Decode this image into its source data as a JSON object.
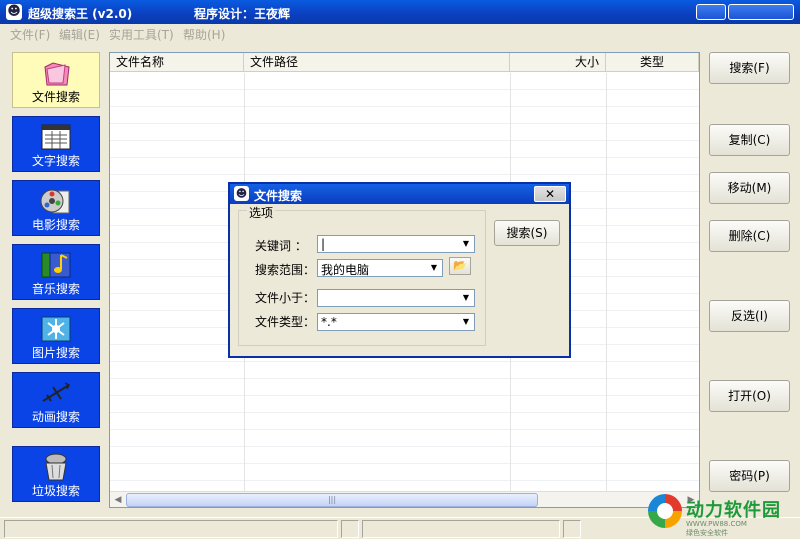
{
  "window": {
    "title": "超级搜索王 (v2.0)",
    "designer": "程序设计：王夜辉"
  },
  "menu": [
    "文件(F)",
    "编辑(E)",
    "实用工具(T)",
    "帮助(H)"
  ],
  "sidebar": {
    "items": [
      {
        "label": "文件搜索",
        "icon": "folder-icon",
        "active": true
      },
      {
        "label": "文字搜索",
        "icon": "text-document-icon"
      },
      {
        "label": "电影搜索",
        "icon": "film-reel-icon"
      },
      {
        "label": "音乐搜索",
        "icon": "music-note-icon"
      },
      {
        "label": "图片搜索",
        "icon": "picture-icon"
      },
      {
        "label": "动画搜索",
        "icon": "airplane-animation-icon"
      },
      {
        "label": "垃圾搜索",
        "icon": "trash-can-icon"
      }
    ]
  },
  "list": {
    "columns": [
      "文件名称",
      "文件路径",
      "大小",
      "类型"
    ],
    "rows": []
  },
  "buttons": {
    "search": "搜索(F)",
    "copy": "复制(C)",
    "move": "移动(M)",
    "delete": "删除(C)",
    "invert": "反选(I)",
    "open": "打开(O)",
    "password": "密码(P)"
  },
  "dialog": {
    "title": "文件搜索",
    "close": "✕",
    "group_title": "选项",
    "keyword_label": "关键词 ：",
    "keyword_value": "|",
    "scope_label": "搜索范围：",
    "scope_value": "我的电脑",
    "size_label": "文件小于：",
    "size_value": "",
    "type_label": "文件类型：",
    "type_value": "*.*",
    "search_button": "搜索(S)"
  },
  "watermark": {
    "brand": "动力软件园",
    "url": "WWW.PW88.COM",
    "slogan": "绿色安全软件"
  },
  "colors": {
    "titlebar": "#0b3fc0",
    "sidebar_item": "#0a44e6",
    "sidebar_active": "#fffbb8",
    "dialog_border": "#0831a8"
  }
}
